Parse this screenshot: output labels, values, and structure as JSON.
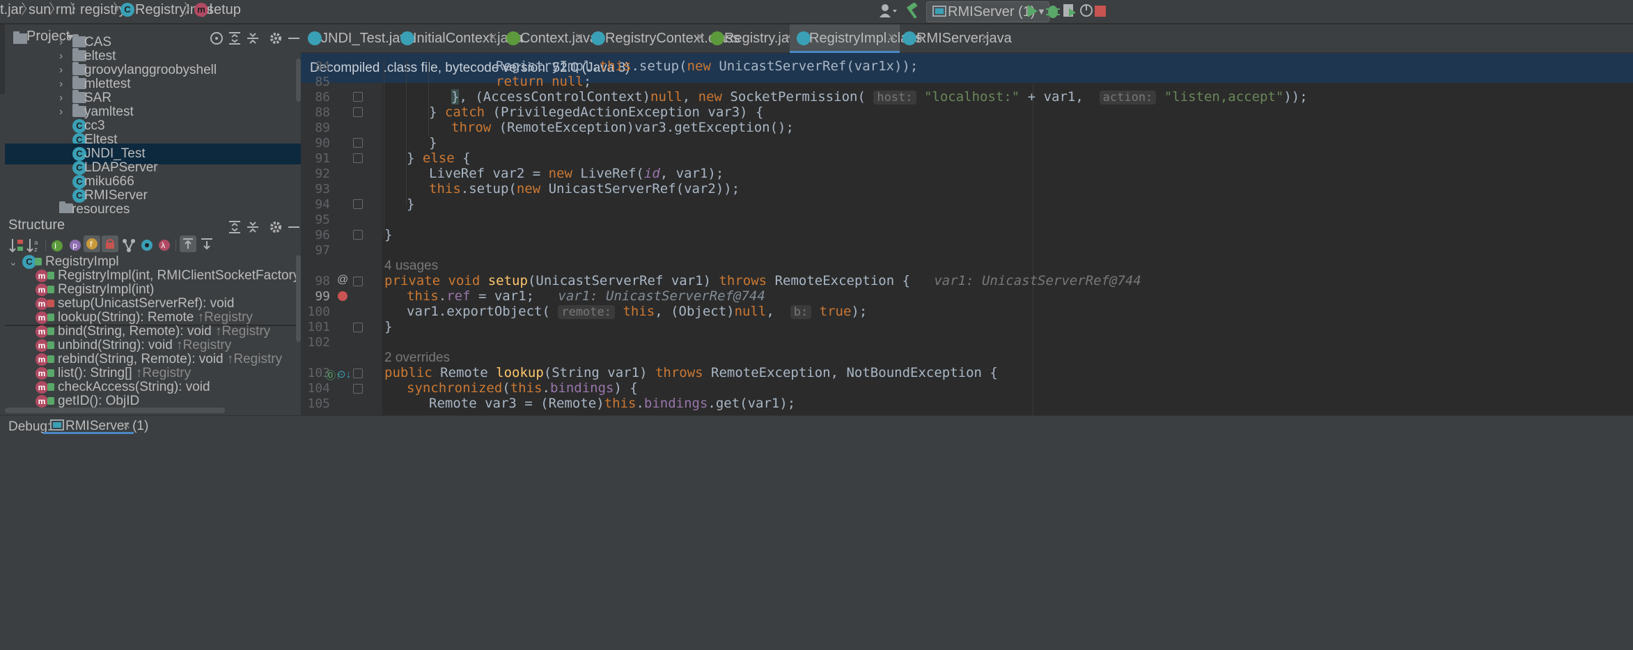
{
  "breadcrumb": [
    {
      "label": "t.jar",
      "icon": "jar-icon"
    },
    {
      "label": "sun",
      "icon": "folder-icon"
    },
    {
      "label": "rmi",
      "icon": "folder-icon"
    },
    {
      "label": "registry",
      "icon": "folder-icon"
    },
    {
      "label": "RegistryImpl",
      "icon": "class-icon"
    },
    {
      "label": "setup",
      "icon": "method-icon"
    }
  ],
  "toolbar": {
    "run_config": "RMIServer (1)",
    "icons": [
      "user-icon",
      "build-hammer-icon",
      "run-icon",
      "debug-icon",
      "coverage-icon",
      "profile-icon",
      "stop-icon"
    ]
  },
  "project_panel": {
    "title": "Project",
    "tree": [
      {
        "label": "CAS",
        "type": "folder"
      },
      {
        "label": "eltest",
        "type": "folder"
      },
      {
        "label": "groovylanggroobyshell",
        "type": "folder"
      },
      {
        "label": "mlettest",
        "type": "folder"
      },
      {
        "label": "SAR",
        "type": "folder"
      },
      {
        "label": "yamltest",
        "type": "folder"
      },
      {
        "label": "cc3",
        "type": "class"
      },
      {
        "label": "Eltest",
        "type": "class"
      },
      {
        "label": "JNDI_Test",
        "type": "class",
        "selected": true
      },
      {
        "label": "LDAPServer",
        "type": "class"
      },
      {
        "label": "miku666",
        "type": "class"
      },
      {
        "label": "RMIServer",
        "type": "class"
      },
      {
        "label": "resources",
        "type": "folder"
      }
    ]
  },
  "structure_panel": {
    "title": "Structure",
    "root": "RegistryImpl",
    "members": [
      {
        "name": "RegistryImpl(int, RMIClientSocketFactory, RMIServerSocketFa",
        "suffix": "",
        "visibility": "public"
      },
      {
        "name": "RegistryImpl(int)",
        "suffix": "",
        "visibility": "public"
      },
      {
        "name": "setup(UnicastServerRef): void",
        "suffix": "",
        "visibility": "private"
      },
      {
        "name": "lookup(String): Remote ",
        "suffix": "↑Registry",
        "visibility": "public"
      },
      {
        "name": "bind(String, Remote): void ",
        "suffix": "↑Registry",
        "visibility": "public"
      },
      {
        "name": "unbind(String): void ",
        "suffix": "↑Registry",
        "visibility": "public"
      },
      {
        "name": "rebind(String, Remote): void ",
        "suffix": "↑Registry",
        "visibility": "public"
      },
      {
        "name": "list(): String[] ",
        "suffix": "↑Registry",
        "visibility": "public"
      },
      {
        "name": "checkAccess(String): void",
        "suffix": "",
        "visibility": "public"
      },
      {
        "name": "getID(): ObjID",
        "suffix": "",
        "visibility": "public"
      }
    ]
  },
  "editor": {
    "tabs": [
      {
        "label": "JNDI_Test.java",
        "icon": "class-icon",
        "active": false
      },
      {
        "label": "InitialContext.java",
        "icon": "class-icon",
        "active": false
      },
      {
        "label": "Context.java",
        "icon": "interface-icon",
        "active": false
      },
      {
        "label": "RegistryContext.class",
        "icon": "class-icon",
        "active": false
      },
      {
        "label": "Registry.java",
        "icon": "interface-icon",
        "active": false
      },
      {
        "label": "RegistryImpl.class",
        "icon": "class-icon",
        "active": true
      },
      {
        "label": "RMIServer.java",
        "icon": "class-icon",
        "active": false
      }
    ],
    "banner": "Decompiled .class file, bytecode version: 52.0 (Java 8)",
    "line_numbers": [
      "84",
      "85",
      "86",
      "88",
      "89",
      "90",
      "91",
      "92",
      "93",
      "94",
      "95",
      "96",
      "97",
      "98",
      "99",
      "100",
      "101",
      "102",
      "103",
      "104",
      "105"
    ],
    "usages_hint": "4 usages",
    "overrides_hint": "2 overrides",
    "current_line": "99"
  },
  "debug_bar": {
    "label": "Debug:",
    "session": "RMIServer (1)"
  },
  "colors": {
    "keyword": "#cc7832",
    "field": "#9876aa",
    "string": "#6a8759",
    "method": "#ffc66d",
    "selection": "#2d5c8f",
    "banner": "#1f3650"
  }
}
